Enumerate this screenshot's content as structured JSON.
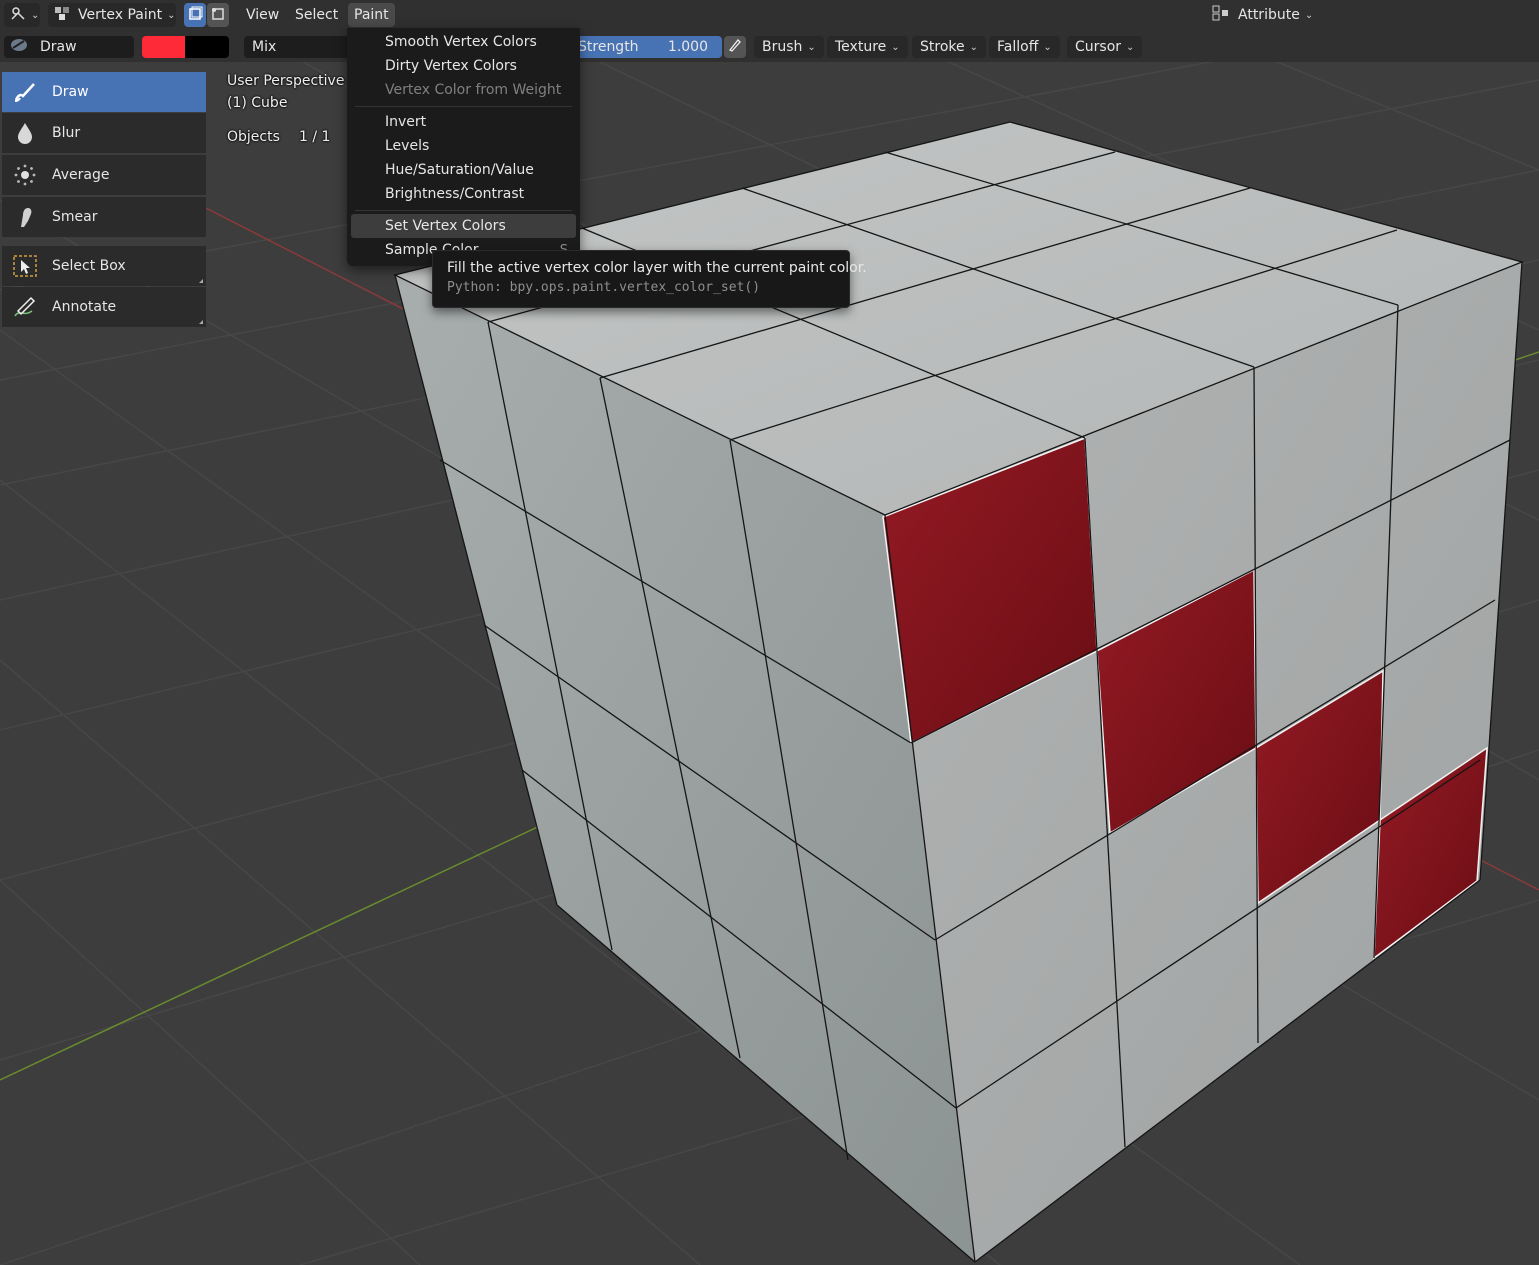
{
  "header": {
    "mode": "Vertex Paint",
    "menus": [
      "View",
      "Select",
      "Paint"
    ],
    "attribute": "Attribute"
  },
  "tool_settings": {
    "brush_name": "Draw",
    "primary_color": "#ff2a38",
    "secondary_color": "#000000",
    "blend": "Mix",
    "strength_label": "Strength",
    "strength_value": "1.000",
    "panels": [
      "Brush",
      "Texture",
      "Stroke",
      "Falloff",
      "Cursor"
    ]
  },
  "toolbar": {
    "tools": [
      "Draw",
      "Blur",
      "Average",
      "Smear"
    ],
    "extra_tools": [
      "Select Box",
      "Annotate"
    ]
  },
  "overlay": {
    "perspective": "User Perspective",
    "object": "(1) Cube",
    "objects_label": "Objects",
    "objects_count": "1 / 1"
  },
  "paint_menu": {
    "group1": [
      "Smooth Vertex Colors",
      "Dirty Vertex Colors",
      "Vertex Color from Weight"
    ],
    "group2": [
      "Invert",
      "Levels",
      "Hue/Saturation/Value",
      "Brightness/Contrast"
    ],
    "group3": [
      "Set Vertex Colors",
      "Sample Color"
    ],
    "sample_shortcut": "S"
  },
  "tooltip": {
    "description": "Fill the active vertex color layer with the current paint color.",
    "python": "Python: bpy.ops.paint.vertex_color_set()"
  },
  "colors": {
    "active_tool": "#4772b3",
    "painted_face": "#8c1520",
    "mesh_face": "#b4b8b8"
  }
}
